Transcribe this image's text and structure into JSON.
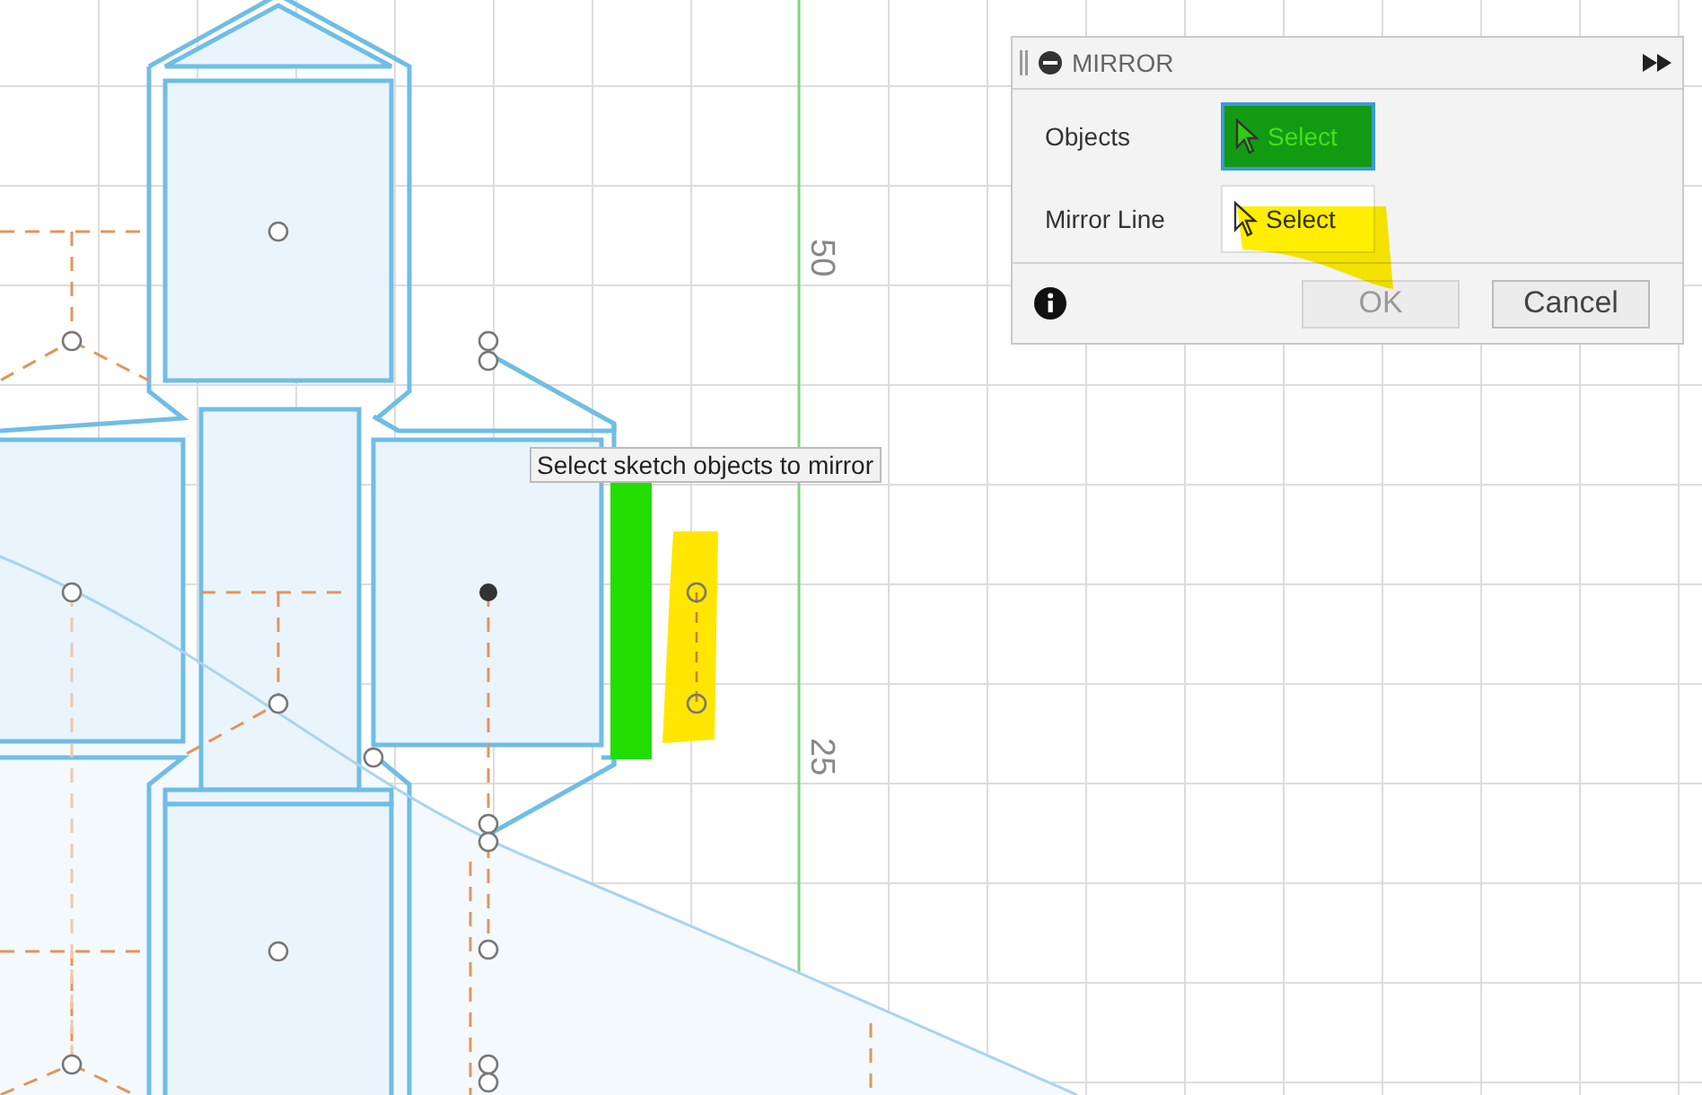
{
  "canvas": {
    "axis_labels": [
      {
        "text": "50"
      },
      {
        "text": "25"
      }
    ],
    "tooltip": "Select sketch objects to mirror"
  },
  "dialog": {
    "title": "MIRROR",
    "rows": [
      {
        "label": "Objects",
        "button": "Select",
        "selected": true
      },
      {
        "label": "Mirror Line",
        "button": "Select",
        "selected": false
      }
    ],
    "ok": {
      "label": "OK",
      "disabled": true
    },
    "cancel": {
      "label": "Cancel",
      "disabled": false
    }
  }
}
